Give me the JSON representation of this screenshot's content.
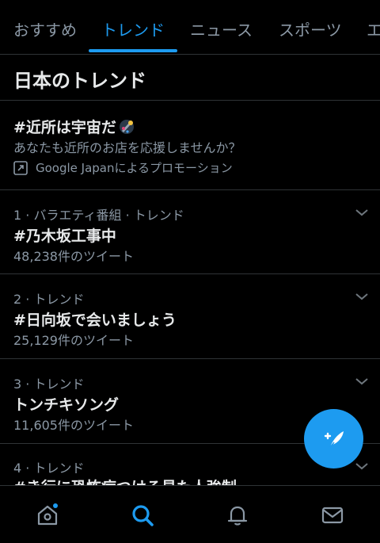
{
  "tabs": [
    {
      "label": "おすすめ"
    },
    {
      "label": "トレンド"
    },
    {
      "label": "ニュース"
    },
    {
      "label": "スポーツ"
    },
    {
      "label": "エ"
    }
  ],
  "section_title": "日本のトレンド",
  "promo": {
    "title": "#近所は宇宙だ",
    "description": "あなたも近所のお店を応援しませんか？",
    "sponsor": "Google Japanによるプロモーション"
  },
  "trends": [
    {
      "meta": "1 · バラエティ番組 · トレンド",
      "name": "#乃木坂工事中",
      "count": "48,238件のツイート"
    },
    {
      "meta": "2 · トレンド",
      "name": "#日向坂で会いましょう",
      "count": "25,129件のツイート"
    },
    {
      "meta": "3 · トレンド",
      "name": "トンチキソング",
      "count": "11,605件のツイート"
    },
    {
      "meta": "4 · トレンド",
      "name": "#き行に恐怖症つける見た人強制",
      "count": ""
    }
  ],
  "colors": {
    "accent": "#1d9bf0",
    "background": "#000000",
    "secondary_text": "#8b98a5"
  },
  "icons": {
    "fab": "compose-tweet-icon",
    "nav": [
      "home-icon",
      "search-icon",
      "notifications-icon",
      "messages-icon"
    ]
  }
}
